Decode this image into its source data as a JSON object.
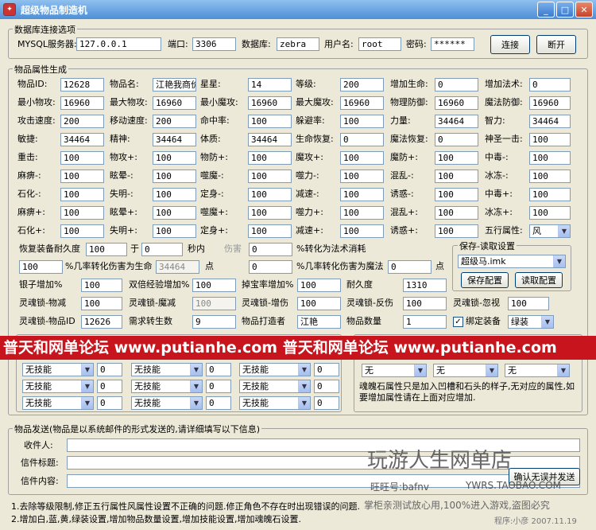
{
  "window": {
    "title": "超级物品制造机"
  },
  "db": {
    "group_title": "数据库连接选项",
    "server_label": "MYSQL服务器:",
    "server": "127.0.0.1",
    "port_label": "端口:",
    "port": "3306",
    "db_label": "数据库:",
    "db": "zebra",
    "user_label": "用户名:",
    "user": "root",
    "pwd_label": "密码:",
    "pwd": "******",
    "connect": "连接",
    "disconnect": "断开"
  },
  "attr": {
    "group_title": "物品属性生成",
    "rows": [
      [
        [
          "物品ID:",
          "12628"
        ],
        [
          "物品名:",
          "江艳我商价"
        ],
        [
          "星星:",
          "14"
        ],
        [
          "等级:",
          "200"
        ],
        [
          "增加生命:",
          "0"
        ],
        [
          "增加法术:",
          "0"
        ]
      ],
      [
        [
          "最小物攻:",
          "16960"
        ],
        [
          "最大物攻:",
          "16960"
        ],
        [
          "最小魔攻:",
          "16960"
        ],
        [
          "最大魔攻:",
          "16960"
        ],
        [
          "物理防御:",
          "16960"
        ],
        [
          "魔法防御:",
          "16960"
        ]
      ],
      [
        [
          "攻击速度:",
          "200"
        ],
        [
          "移动速度:",
          "200"
        ],
        [
          "命中率:",
          "100"
        ],
        [
          "躲避率:",
          "100"
        ],
        [
          "力量:",
          "34464"
        ],
        [
          "智力:",
          "34464"
        ]
      ],
      [
        [
          "敏捷:",
          "34464"
        ],
        [
          "精神:",
          "34464"
        ],
        [
          "体质:",
          "34464"
        ],
        [
          "生命恢复:",
          "0"
        ],
        [
          "魔法恢复:",
          "0"
        ],
        [
          "神圣一击:",
          "100"
        ]
      ],
      [
        [
          "重击:",
          "100"
        ],
        [
          "物攻+:",
          "100"
        ],
        [
          "物防+:",
          "100"
        ],
        [
          "魔攻+:",
          "100"
        ],
        [
          "魔防+:",
          "100"
        ],
        [
          "中毒-:",
          "100"
        ]
      ],
      [
        [
          "麻痹-:",
          "100"
        ],
        [
          "眩晕-:",
          "100"
        ],
        [
          "噬魔-:",
          "100"
        ],
        [
          "噬力-:",
          "100"
        ],
        [
          "混乱-:",
          "100"
        ],
        [
          "冰冻-:",
          "100"
        ]
      ],
      [
        [
          "石化-:",
          "100"
        ],
        [
          "失明-:",
          "100"
        ],
        [
          "定身-:",
          "100"
        ],
        [
          "减速-:",
          "100"
        ],
        [
          "诱惑-:",
          "100"
        ],
        [
          "中毒+:",
          "100"
        ]
      ],
      [
        [
          "麻痹+:",
          "100"
        ],
        [
          "眩晕+:",
          "100"
        ],
        [
          "噬魔+:",
          "100"
        ],
        [
          "噬力+:",
          "100"
        ],
        [
          "混乱+:",
          "100"
        ],
        [
          "冰冻+:",
          "100"
        ]
      ],
      [
        [
          "石化+:",
          "100"
        ],
        [
          "失明+:",
          "100"
        ],
        [
          "定身+:",
          "100"
        ],
        [
          "减速+:",
          "100"
        ],
        [
          "诱惑+:",
          "100"
        ],
        [
          "五行属性:",
          "风"
        ]
      ]
    ],
    "restore_label": "恢复装备耐久度",
    "restore_val": "100",
    "yu": "于",
    "zero": "0",
    "secs": "秒内",
    "dmg": "伤害",
    "dmg_val": "0",
    "to_magic": "%转化为法术消耗",
    "pct_val": "100",
    "to_hp": "%几率转化伤害为生命",
    "hp_val": "34464",
    "dian": "点",
    "mg_val": "0",
    "to_mp": "%几率转化伤害为魔法",
    "mp_val": "0",
    "dian2": "点",
    "silver_label": "银子增加%",
    "silver": "100",
    "exp_label": "双倍经验增加%",
    "exp": "100",
    "treasure_label": "掉宝率增加%",
    "treasure": "100",
    "dur_label": "耐久度",
    "dur": "1310",
    "soul_phys_label": "灵魂锁-物减",
    "soul_phys": "100",
    "soul_mag_label": "灵魂锁-魔减",
    "soul_mag": "100",
    "soul_hp_label": "灵魂锁-增伤",
    "soul_hp": "100",
    "soul_ref_label": "灵魂锁-反伤",
    "soul_ref": "100",
    "soul_ign_label": "灵魂锁-忽视",
    "soul_ign": "100",
    "soul_id_label": "灵魂锁-物品ID",
    "soul_id": "12626",
    "need_label": "需求转生数",
    "need": "9",
    "maker_label": "物品打造者",
    "maker": "江艳",
    "qty_label": "物品数量",
    "qty": "1",
    "bind_label": "绑定装备",
    "bind_val": "绿装"
  },
  "saveload": {
    "title": "保存-读取设置",
    "file": "超级马.imk",
    "save": "保存配置",
    "load": "读取配置"
  },
  "banner": {
    "text": "普天和网单论坛 www.putianhe.com 普天和网单论坛 www.putianhe.com"
  },
  "skills": {
    "opt": "无技能",
    "zero": "0"
  },
  "soulstone": {
    "opt": "无",
    "note": "魂魄石属性只是加入凹槽和石头的样子,无对应的属性,如要增加属性请在上面对应增加."
  },
  "mail": {
    "title": "物品发送(物品是以系统邮件的形式发送的,请详细填写以下信息)",
    "recv": "收件人:",
    "subject": "信件标题:",
    "content": "信件内容:",
    "send": "确认无误并发送"
  },
  "notes": {
    "n1": "1.去除等级限制,修正五行属性风属性设置不正确的问题.修正角色不存在时出现错误的问题.",
    "n2": "2.增加白,蓝,黄,绿装设置,增加物品数量设置,增加技能设置,增加魂魄石设置."
  },
  "watermark": {
    "shop": "玩游人生网单店",
    "wangwang": "旺旺号:bafnv",
    "site": "YWRS.TAOBAO.COM",
    "slogan": "掌柜亲测试放心用,100%进入游戏,盗图必究",
    "credit": "程序:小彦 2007.11.19"
  }
}
